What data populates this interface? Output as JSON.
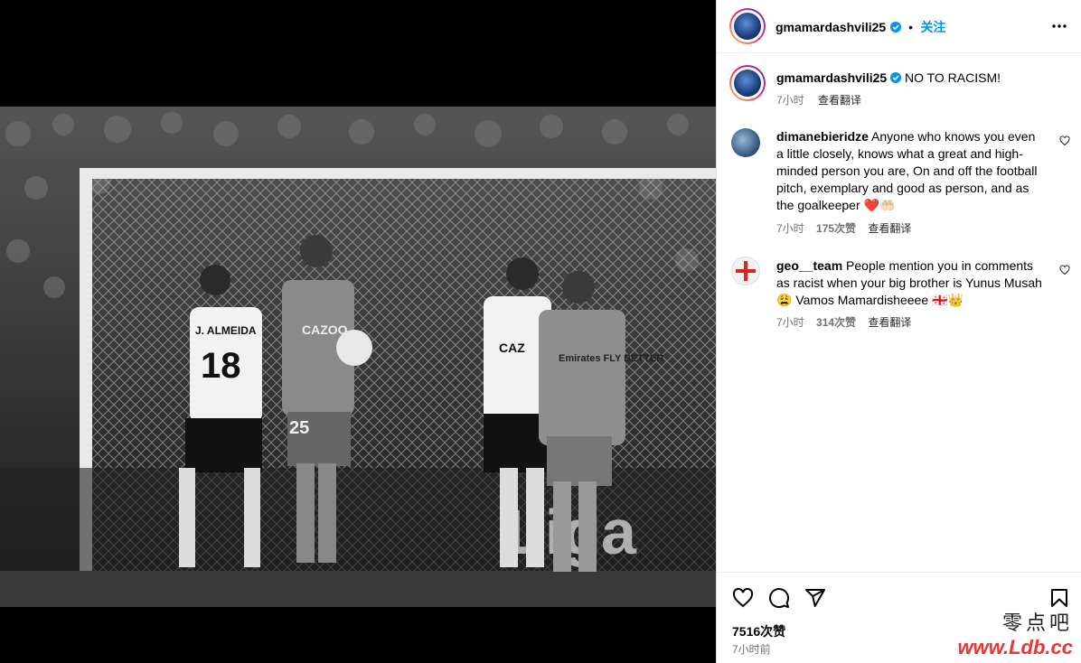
{
  "post": {
    "username": "gmamardashvili25",
    "dot": "•",
    "follow_label": "关注",
    "more_icon": "more-horizontal-icon"
  },
  "caption": {
    "username": "gmamardashvili25",
    "text": "NO TO RACISM!",
    "time": "7小时",
    "translate": "查看翻译"
  },
  "comments": [
    {
      "username": "dimanebieridze",
      "text": "Anyone who knows you even a little closely, knows what a great and high-minded person you are, On and off the football pitch, exemplary and good as person, and as the goalkeeper ❤️🤲🏻",
      "time": "7小时",
      "likes": "175次赞",
      "translate": "查看翻译"
    },
    {
      "username": "geo__team",
      "text": "People mention you in comments as racist when your big brother is Yunus Musah 😩 Vamos Mamardisheeee 🇬🇪👑",
      "time": "7小时",
      "likes": "314次赞",
      "translate": "查看翻译"
    }
  ],
  "actions": {
    "likes_count": "7516次赞",
    "posted": "7小时前"
  },
  "photo": {
    "player_names": [
      "J. ALMEIDA",
      "18",
      "25",
      "CAZOO",
      "Emirates FLY BETTER"
    ]
  },
  "watermark": {
    "line1": "零点吧",
    "line2": "www.Ldb.cc"
  }
}
